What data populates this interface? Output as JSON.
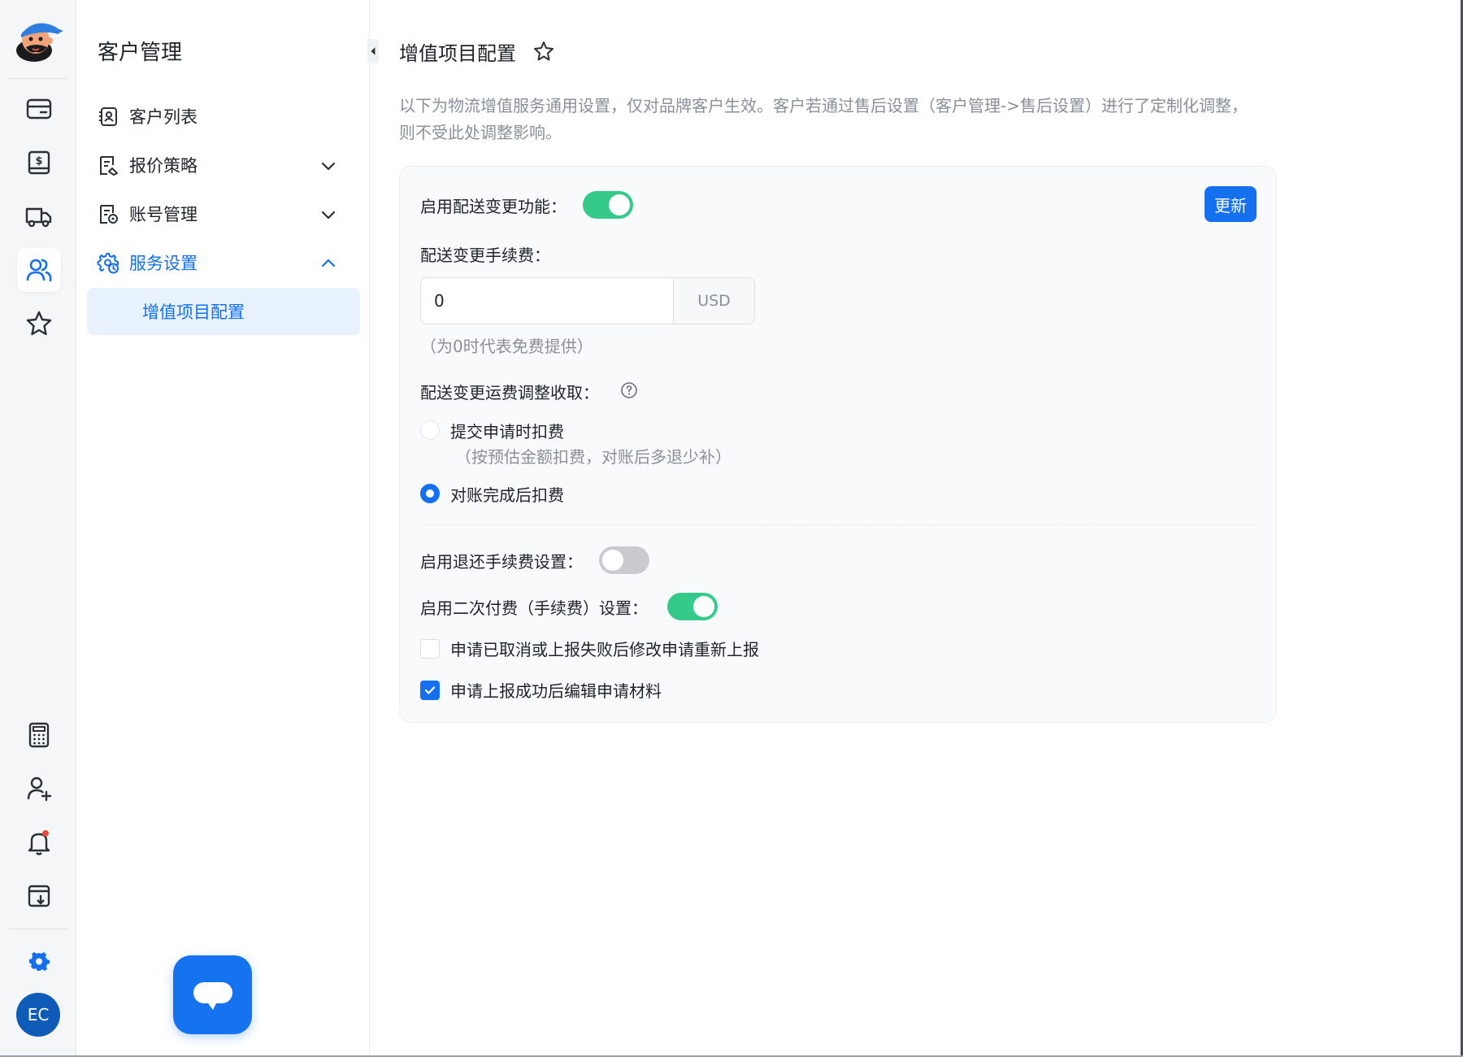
{
  "colors": {
    "accent": "#1570ef",
    "toggle_on": "#35c98a",
    "toggle_off": "#c9cbd0",
    "muted_text": "#8a8f99"
  },
  "rail": {
    "icons": [
      "wallet-icon",
      "dollar-bill-icon",
      "truck-icon",
      "users-icon",
      "star-icon",
      "calculator-icon",
      "add-user-icon",
      "bell-icon",
      "download-box-icon",
      "settings-gear-icon"
    ],
    "active": "users-icon",
    "avatar_initials": "EC"
  },
  "sidebar": {
    "title": "客户管理",
    "items": [
      {
        "label": "客户列表",
        "icon": "contact-card-icon"
      },
      {
        "label": "报价策略",
        "icon": "price-doc-icon",
        "expandable": true
      },
      {
        "label": "账号管理",
        "icon": "account-doc-icon",
        "expandable": true
      },
      {
        "label": "服务设置",
        "icon": "service-gear-icon",
        "expandable": true,
        "expanded": true
      }
    ],
    "subitem": {
      "label": "增值项目配置",
      "selected": true
    }
  },
  "main": {
    "title": "增值项目配置",
    "description": "以下为物流增值服务通用设置，仅对品牌客户生效。客户若通过售后设置（客户管理->售后设置）进行了定制化调整，则不受此处调整影响。",
    "update_button": "更新",
    "delivery_change": {
      "label": "启用配送变更功能：",
      "enabled": true
    },
    "fee": {
      "label": "配送变更手续费：",
      "value": "0",
      "unit": "USD",
      "hint": "（为0时代表免费提供）"
    },
    "freight_adjust": {
      "label": "配送变更运费调整收取：",
      "options": [
        {
          "label": "提交申请时扣费",
          "sub": "（按预估金额扣费，对账后多退少补）",
          "checked": false
        },
        {
          "label": "对账完成后扣费",
          "checked": true
        }
      ]
    },
    "refund_fee": {
      "label": "启用退还手续费设置：",
      "enabled": false
    },
    "second_payment": {
      "label": "启用二次付费（手续费）设置：",
      "enabled": true
    },
    "checkboxes": [
      {
        "label": "申请已取消或上报失败后修改申请重新上报",
        "checked": false
      },
      {
        "label": "申请上报成功后编辑申请材料",
        "checked": true
      }
    ]
  }
}
